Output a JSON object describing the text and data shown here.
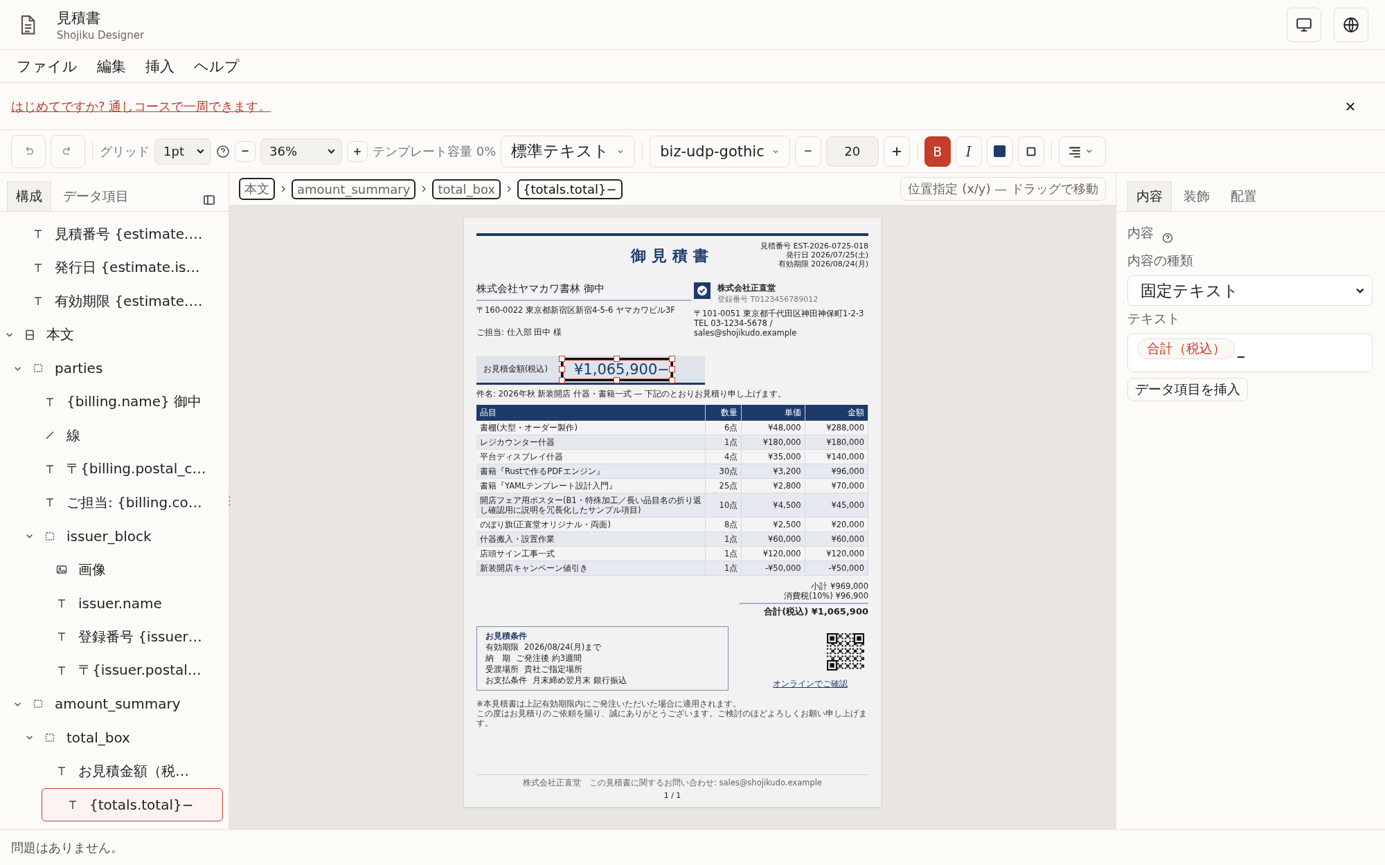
{
  "app": {
    "title": "見積書",
    "subtitle": "Shojiku Designer"
  },
  "header_buttons": [
    {
      "kind": "monitor"
    },
    {
      "kind": "globe"
    }
  ],
  "menu": [
    "ファイル",
    "編集",
    "挿入",
    "ヘルプ"
  ],
  "banner": {
    "link": "はじめてですか? 通しコースで一周できます。"
  },
  "toolbar": {
    "grid_label": "グリッド",
    "grid_value": "1pt",
    "zoom_value": "36%",
    "capacity": "テンプレート容量 0%",
    "style": "標準テキスト",
    "font": "biz-udp-gothic",
    "font_size": "20",
    "bold_label": "B",
    "italic_label": "I",
    "bold": true,
    "italic": false
  },
  "sidebar": {
    "tabs": [
      {
        "label": "構成",
        "selected": true
      },
      {
        "label": "データ項目",
        "selected": false
      }
    ],
    "tree": [
      {
        "children": [
          {
            "kind": "text",
            "label": "見積番号 {estimate.…",
            "selected": false
          },
          {
            "kind": "text",
            "label": "発行日 {estimate.is…",
            "selected": false
          },
          {
            "kind": "text",
            "label": "有効期限 {estimate.…",
            "selected": false
          }
        ]
      },
      {
        "kind": "section",
        "label": "本文",
        "expanded": true,
        "selected": false,
        "children": [
          {
            "kind": "group",
            "label": "parties",
            "expanded": true,
            "selected": false,
            "children": [
              {
                "kind": "text",
                "label": "{billing.name} 御中",
                "selected": false
              },
              {
                "kind": "line",
                "label": "線",
                "selected": false
              },
              {
                "kind": "text",
                "label": "〒{billing.postal_c…",
                "selected": false
              },
              {
                "kind": "text",
                "label": "ご担当: {billing.co…",
                "selected": false
              },
              {
                "kind": "group",
                "label": "issuer_block",
                "expanded": true,
                "selected": false,
                "children": [
                  {
                    "kind": "image",
                    "label": "画像",
                    "selected": false
                  },
                  {
                    "kind": "text",
                    "label": "issuer.name",
                    "selected": false
                  },
                  {
                    "kind": "text",
                    "label": "登録番号 {issuer…",
                    "selected": false
                  },
                  {
                    "kind": "text",
                    "label": "〒{issuer.postal…",
                    "selected": false
                  }
                ]
              }
            ]
          },
          {
            "kind": "group",
            "label": "amount_summary",
            "expanded": true,
            "selected": false,
            "children": [
              {
                "kind": "group",
                "label": "total_box",
                "expanded": true,
                "selected": false,
                "children": [
                  {
                    "kind": "text",
                    "label": "お見積金額（税…",
                    "selected": false
                  },
                  {
                    "kind": "text",
                    "label": "{totals.total}−",
                    "selected": true
                  }
                ]
              }
            ]
          }
        ]
      }
    ]
  },
  "breadcrumbs": [
    {
      "label": "本文",
      "selected": false
    },
    {
      "label": "amount_summary",
      "selected": false
    },
    {
      "label": "total_box",
      "selected": false
    },
    {
      "label": "{totals.total}−",
      "selected": true
    }
  ],
  "position_button": "位置指定 (x/y) — ドラッグで移動",
  "document": {
    "title": "御見積書",
    "meta": [
      "見積番号 EST-2026-0725-018",
      "発行日 2026/07/25(土)",
      "有効期限 2026/08/24(月)"
    ],
    "billing": {
      "name": "株式会社ヤマカワ書林 御中",
      "address": "〒160-0022 東京都新宿区新宿4-5-6 ヤマカワビル3F",
      "contact": "ご担当: 仕入部 田中 様"
    },
    "issuer": {
      "name": "株式会社正直堂",
      "registration": "登録番号 T0123456789012",
      "address": "〒101-0051 東京都千代田区神田神保町1-2-3",
      "contact": "TEL 03-1234-5678 / sales@shojikudo.example"
    },
    "amount": {
      "label": "お見積金額(税込)",
      "value": "¥1,065,900−",
      "selected": true
    },
    "subject": "件名: 2026年秋 新装開店 什器・書籍一式 — 下記のとおりお見積り申し上げます。",
    "table": {
      "columns": [
        "品目",
        "数量",
        "単価",
        "金額"
      ],
      "rows": [
        [
          "書棚(大型・オーダー製作)",
          "6点",
          "¥48,000",
          "¥288,000"
        ],
        [
          "レジカウンター什器",
          "1点",
          "¥180,000",
          "¥180,000"
        ],
        [
          "平台ディスプレイ什器",
          "4点",
          "¥35,000",
          "¥140,000"
        ],
        [
          "書籍『Rustで作るPDFエンジン』",
          "30点",
          "¥3,200",
          "¥96,000"
        ],
        [
          "書籍『YAMLテンプレート設計入門』",
          "25点",
          "¥2,800",
          "¥70,000"
        ],
        [
          "開店フェア用ポスター(B1・特殊加工／長い品目名の折り返し確認用に説明を冗長化したサンプル項目)",
          "10点",
          "¥4,500",
          "¥45,000"
        ],
        [
          "のぼり旗(正直堂オリジナル・両面)",
          "8点",
          "¥2,500",
          "¥20,000"
        ],
        [
          "什器搬入・設置作業",
          "1点",
          "¥60,000",
          "¥60,000"
        ],
        [
          "店頭サイン工事一式",
          "1点",
          "¥120,000",
          "¥120,000"
        ],
        [
          "新装開店キャンペーン値引き",
          "1点",
          "-¥50,000",
          "-¥50,000"
        ]
      ]
    },
    "totals": {
      "subtotal": "小計 ¥969,000",
      "tax": "消費税(10%) ¥96,900",
      "total": "合計(税込) ¥1,065,900"
    },
    "conditions": {
      "title": "お見積条件",
      "lines": [
        {
          "label": "有効期限",
          "value": "2026/08/24(月)まで"
        },
        {
          "label": "納　期",
          "value": "ご発注後 約3週間"
        },
        {
          "label": "受渡場所",
          "value": "貴社ご指定場所"
        },
        {
          "label": "お支払条件",
          "value": "月末締め翌月末 銀行振込"
        }
      ]
    },
    "qr_link": "オンラインでご確認",
    "notes": [
      "※本見積書は上記有効期限内にご発注いただいた場合に適用されます。",
      "この度はお見積りのご依頼を賜り、誠にありがとうございます。ご検討のほどよろしくお願い申し上げます。"
    ],
    "footer": "株式会社正直堂　この見積書に関するお問い合わせ: sales@shojikudo.example",
    "page_number": "1 / 1"
  },
  "inspector": {
    "tabs": [
      {
        "label": "内容",
        "selected": true
      },
      {
        "label": "装飾",
        "selected": false
      },
      {
        "label": "配置",
        "selected": false
      }
    ],
    "section_label": "内容",
    "type_label": "内容の種類",
    "type_value": "固定テキスト",
    "text_label": "テキスト",
    "chips": [
      "合計（税込）"
    ],
    "insert_button": "データ項目を挿入"
  },
  "status": "問題はありません。"
}
